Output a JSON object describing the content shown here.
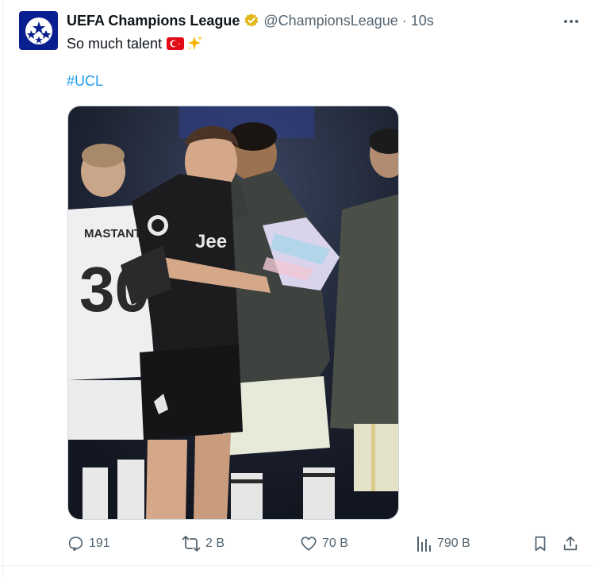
{
  "tweet": {
    "author_name": "UEFA Champions League",
    "handle": "@ChampionsLeague",
    "separator": "·",
    "time": "10s",
    "text": "So much talent",
    "hashtag": "#UCL"
  },
  "actions": {
    "replies": "191",
    "reposts": "2 B",
    "likes": "70 B",
    "views": "790 B"
  },
  "icons": {
    "avatar": "champions-league-starball",
    "verified": "gold-verified-badge",
    "more": "more-horizontal-icon",
    "reply": "reply-icon",
    "repost": "repost-icon",
    "like": "heart-icon",
    "views": "views-chart-icon",
    "bookmark": "bookmark-icon",
    "share": "share-icon"
  },
  "colors": {
    "link": "#1d9bf0",
    "secondary_text": "#536471",
    "verified_gold": "#e2b719",
    "avatar_bg": "#0a1f8f",
    "flag_red": "#e30a17"
  }
}
